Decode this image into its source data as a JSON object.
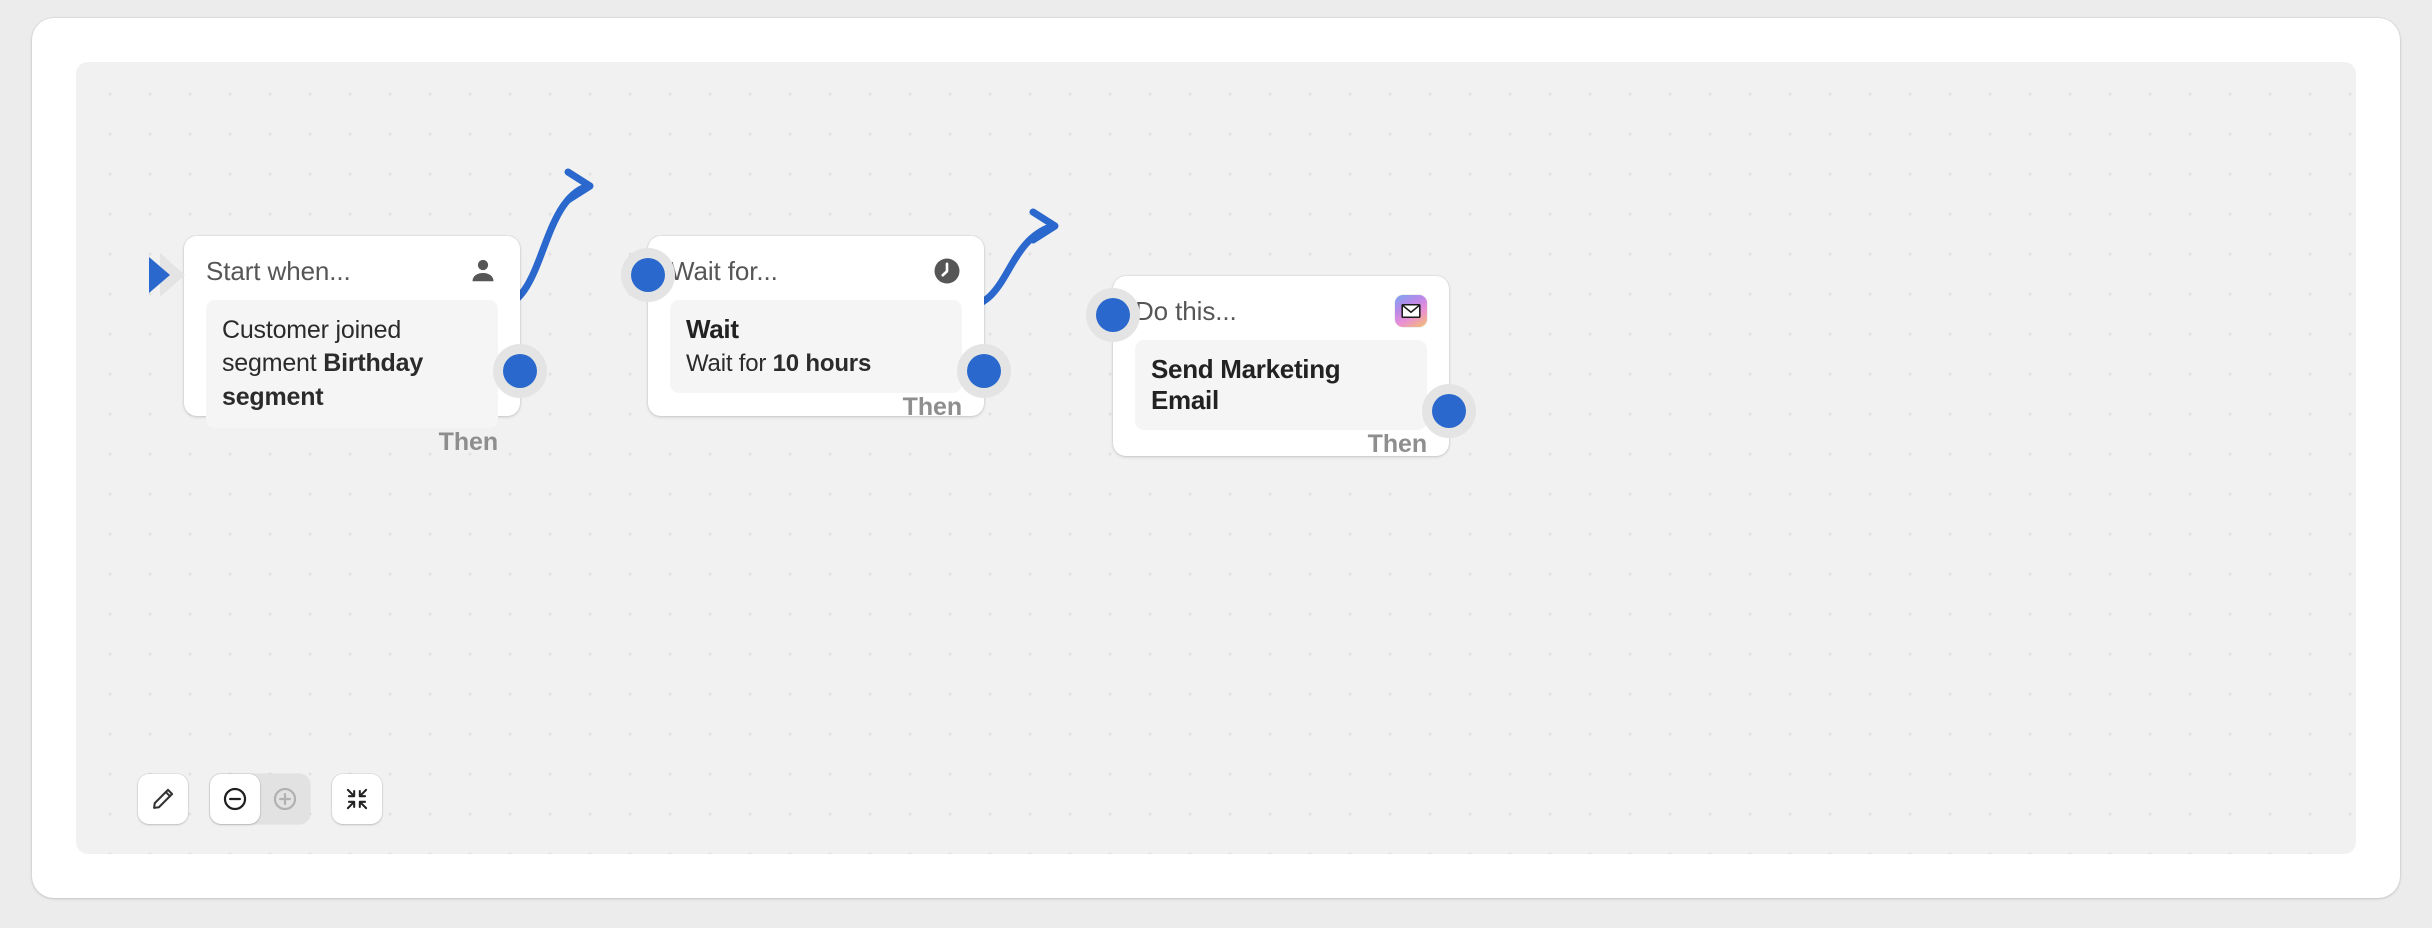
{
  "canvas": {
    "background_color": "#f1f1f1",
    "dot_color": "#e2e2e2",
    "accent_color": "#2a68cd",
    "port_halo_color": "#e4e4e4"
  },
  "nodes": [
    {
      "id": "trigger",
      "title": "Start when...",
      "icon": "person-icon",
      "body_prefix": "Customer joined segment ",
      "body_bold": "Birthday segment",
      "footer_label": "Then",
      "has_start_arrow": true
    },
    {
      "id": "wait",
      "title": "Wait for...",
      "icon": "clock-icon",
      "body_heading": "Wait",
      "body_sub_prefix": "Wait for ",
      "body_sub_bold": "10 hours",
      "footer_label": "Then",
      "has_start_arrow": false
    },
    {
      "id": "action",
      "title": "Do this...",
      "icon": "mail-icon",
      "body_heading": "Send Marketing Email",
      "footer_label": "Then",
      "has_start_arrow": false
    }
  ],
  "toolbar": {
    "edit_label": "Edit",
    "zoom_out_label": "Zoom out",
    "zoom_in_label": "Zoom in",
    "zoom_in_disabled": true,
    "fit_label": "Fit to screen"
  }
}
